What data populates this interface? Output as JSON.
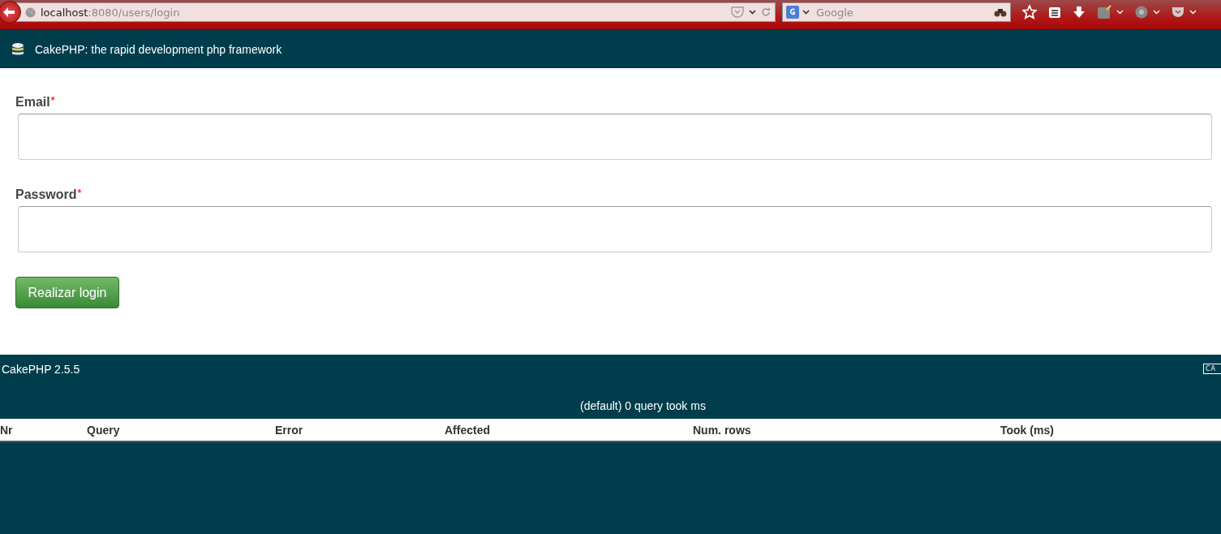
{
  "browser": {
    "url_host": "localhost",
    "url_path": ":8080/users/login",
    "search": {
      "placeholder": "Google"
    }
  },
  "header": {
    "title": "CakePHP: the rapid development php framework"
  },
  "form": {
    "fields": [
      {
        "label": "Email",
        "required_mark": "*"
      },
      {
        "label": "Password",
        "required_mark": "*"
      }
    ],
    "submit": "Realizar login"
  },
  "footer": {
    "version": "CakePHP 2.5.5",
    "badge": "CA"
  },
  "sql_log": {
    "summary": "(default) 0 query took ms",
    "columns": [
      "Nr",
      "Query",
      "Error",
      "Affected",
      "Num. rows",
      "Took (ms)"
    ]
  }
}
